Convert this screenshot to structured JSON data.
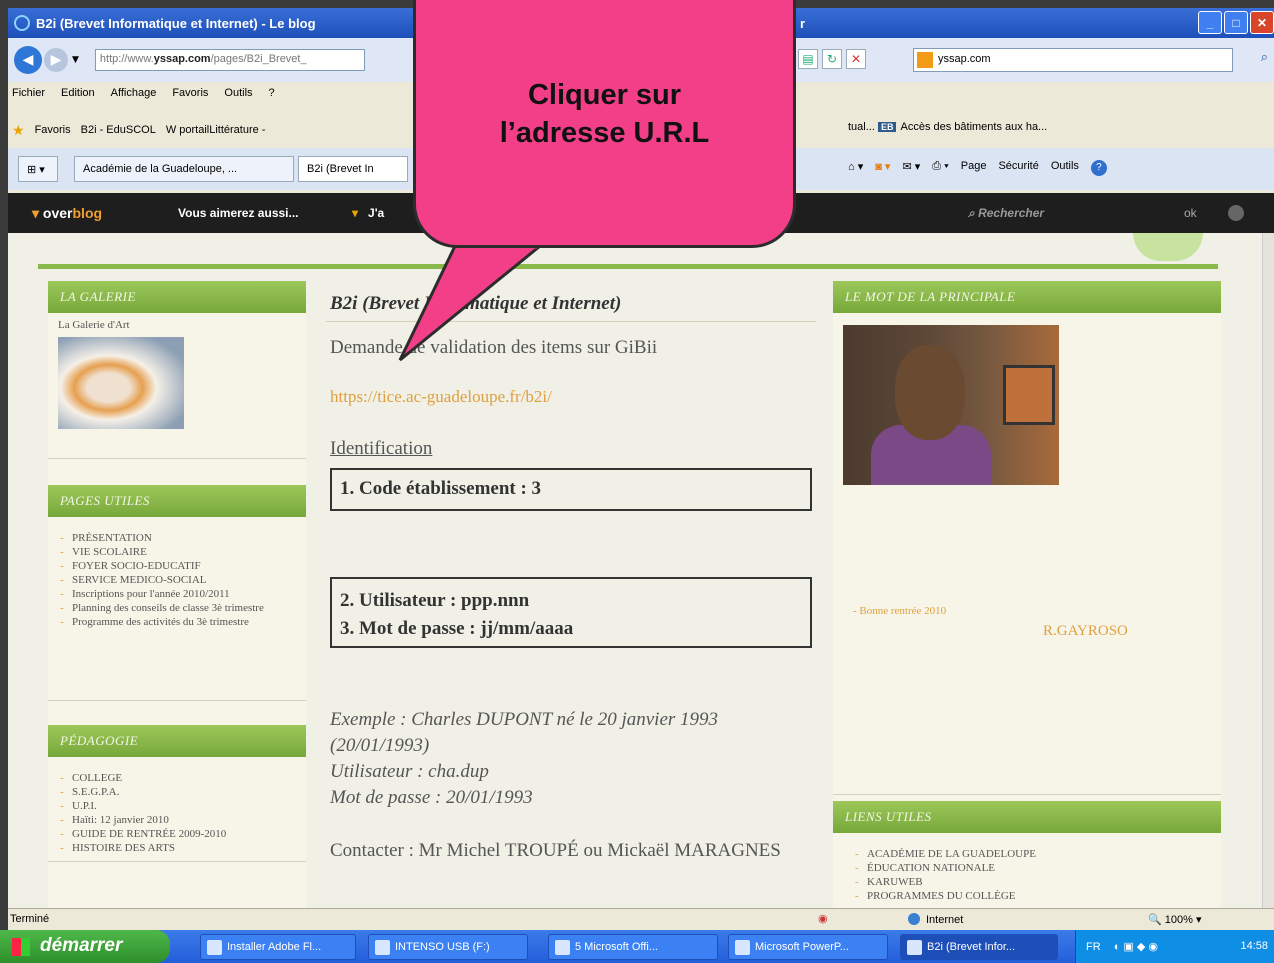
{
  "window": {
    "title": "B2i (Brevet Informatique et Internet) - Le blog",
    "title_right": "r"
  },
  "address": {
    "url_prefix": "http://www.",
    "url_domain": "yssap.com",
    "url_rest": "/pages/B2i_Brevet_",
    "search_value": "yssap.com"
  },
  "menubar": {
    "items": [
      "Fichier",
      "Edition",
      "Affichage",
      "Favoris",
      "Outils",
      "?"
    ]
  },
  "favbar": {
    "favoris": "Favoris",
    "items": [
      "B2i - EduSCOL",
      "W portailLittérature -"
    ],
    "right1": "tual...",
    "right2_badge": "EB",
    "right2": "Accès des bâtiments aux ha..."
  },
  "tabs": {
    "t1": "Académie de la Guadeloupe, ...",
    "t2": "B2i (Brevet In"
  },
  "commandbar": {
    "page": "Page",
    "security": "Sécurité",
    "tools": "Outils"
  },
  "overblog": {
    "logo_a": "over",
    "logo_b": "blog",
    "nav1": "Vous aimerez aussi...",
    "nav2": "J'a",
    "search": "Rechercher",
    "ok": "ok"
  },
  "left": {
    "galerie_title": "La Galerie",
    "galerie_item": "La Galerie d'Art",
    "pages_title": "Pages utiles",
    "pages_items": [
      "PRÉSENTATION",
      "VIE SCOLAIRE",
      "FOYER SOCIO-EDUCATIF",
      "SERVICE MEDICO-SOCIAL",
      "Inscriptions pour l'année 2010/2011",
      "Planning des conseils de classe 3è trimestre",
      "Programme des activités du 3è trimestre"
    ],
    "peda_title": "Pédagogie",
    "peda_items": [
      "COLLEGE",
      "S.E.G.P.A.",
      "U.P.I.",
      "Haïti: 12 janvier 2010",
      "GUIDE DE RENTRÉE 2009-2010",
      "HISTOIRE DES ARTS"
    ]
  },
  "post": {
    "title": "B2i (Brevet Informatique et Internet)",
    "line1": "Demande de validation des items sur GiBii",
    "url": "https://tice.ac-guadeloupe.fr/b2i/",
    "identification": "Identification",
    "code": "1. Code établissement : 3",
    "user": "2. Utilisateur : ppp.nnn",
    "pass": "3. Mot de passe : jj/mm/aaaa",
    "ex1": "Exemple : Charles DUPONT né le 20 janvier 1993 (20/01/1993)",
    "ex2": "Utilisateur : cha.dup",
    "ex3": "Mot de passe : 20/01/1993",
    "contact": "Contacter : Mr Michel TROUPÉ ou Mickaël MARAGNES"
  },
  "right": {
    "mot_title": "Le mot de la principale",
    "news": "Bonne rentrée 2010",
    "signature": "R.GAYROSO",
    "liens_title": "Liens utiles",
    "liens_items": [
      "ACADÉMIE DE LA GUADELOUPE",
      "ÉDUCATION NATIONALE",
      "KARUWEB",
      "PROGRAMMES DU COLLÈGE"
    ]
  },
  "status": {
    "left": "Terminé",
    "zone": "Internet",
    "zoom": "100%"
  },
  "taskbar": {
    "start": "démarrer",
    "tasks": [
      "Installer Adobe Fl...",
      "INTENSO USB (F:)",
      "5 Microsoft Offi...",
      "Microsoft PowerP...",
      "B2i (Brevet Infor..."
    ],
    "lang": "FR",
    "clock": "14:58"
  },
  "callout": {
    "line1": "Cliquer sur",
    "line2": "l’adresse U.R.L"
  },
  "colors": {
    "callout": "#f23f88",
    "green_header": "#8ab84a",
    "link": "#e0a040",
    "xp_blue": "#245edb"
  }
}
